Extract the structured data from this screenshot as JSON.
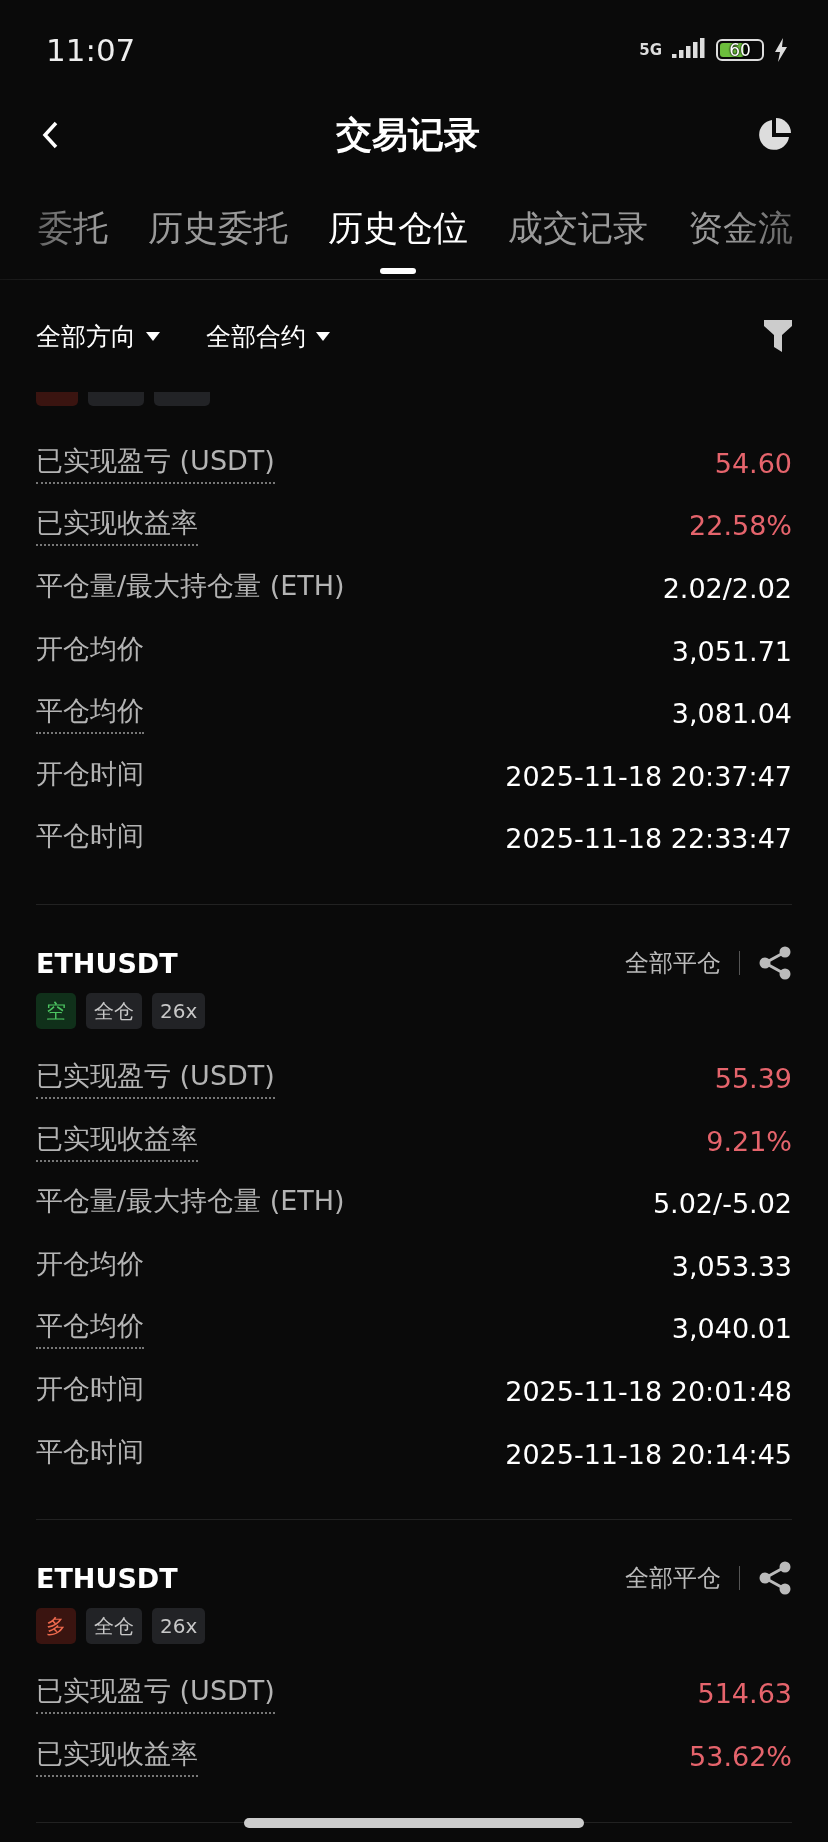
{
  "status_bar": {
    "time": "11:07",
    "network": "5G",
    "battery": "60"
  },
  "header": {
    "title": "交易记录"
  },
  "tabs": [
    {
      "label": "委托",
      "selected": false
    },
    {
      "label": "历史委托",
      "selected": false
    },
    {
      "label": "历史仓位",
      "selected": true
    },
    {
      "label": "成交记录",
      "selected": false
    },
    {
      "label": "资金流",
      "selected": false
    }
  ],
  "filters": [
    {
      "label": "全部方向"
    },
    {
      "label": "全部合约"
    }
  ],
  "positions": [
    {
      "tags": [
        {
          "kind": "long"
        },
        {
          "kind": "plain"
        },
        {
          "kind": "plain"
        }
      ],
      "rows": [
        {
          "label": "已实现盈亏 (USDT)",
          "value": "54.60",
          "dotted": true,
          "accent": true
        },
        {
          "label": "已实现收益率",
          "value": "22.58%",
          "dotted": true,
          "accent": true
        },
        {
          "label": "平仓量/最大持仓量 (ETH)",
          "value": "2.02/2.02",
          "dotted": false,
          "accent": false
        },
        {
          "label": "开仓均价",
          "value": "3,051.71",
          "dotted": false,
          "accent": false
        },
        {
          "label": "平仓均价",
          "value": "3,081.04",
          "dotted": true,
          "accent": false
        },
        {
          "label": "开仓时间",
          "value": "2025-11-18 20:37:47",
          "dotted": false,
          "accent": false
        },
        {
          "label": "平仓时间",
          "value": "2025-11-18 22:33:47",
          "dotted": false,
          "accent": false
        }
      ]
    },
    {
      "symbol": "ETHUSDT",
      "close_type": "全部平仓",
      "tags": [
        {
          "kind": "short",
          "label": "空"
        },
        {
          "kind": "plain",
          "label": "全仓"
        },
        {
          "kind": "plain",
          "label": "26x"
        }
      ],
      "rows": [
        {
          "label": "已实现盈亏 (USDT)",
          "value": "55.39",
          "dotted": true,
          "accent": true
        },
        {
          "label": "已实现收益率",
          "value": "9.21%",
          "dotted": true,
          "accent": true
        },
        {
          "label": "平仓量/最大持仓量 (ETH)",
          "value": "5.02/-5.02",
          "dotted": false,
          "accent": false
        },
        {
          "label": "开仓均价",
          "value": "3,053.33",
          "dotted": false,
          "accent": false
        },
        {
          "label": "平仓均价",
          "value": "3,040.01",
          "dotted": true,
          "accent": false
        },
        {
          "label": "开仓时间",
          "value": "2025-11-18 20:01:48",
          "dotted": false,
          "accent": false
        },
        {
          "label": "平仓时间",
          "value": "2025-11-18 20:14:45",
          "dotted": false,
          "accent": false
        }
      ]
    },
    {
      "symbol": "ETHUSDT",
      "close_type": "全部平仓",
      "tags": [
        {
          "kind": "long",
          "label": "多"
        },
        {
          "kind": "plain",
          "label": "全仓"
        },
        {
          "kind": "plain",
          "label": "26x"
        }
      ],
      "rows": [
        {
          "label": "已实现盈亏 (USDT)",
          "value": "514.63",
          "dotted": true,
          "accent": true
        },
        {
          "label": "已实现收益率",
          "value": "53.62%",
          "dotted": true,
          "accent": true
        }
      ]
    }
  ]
}
